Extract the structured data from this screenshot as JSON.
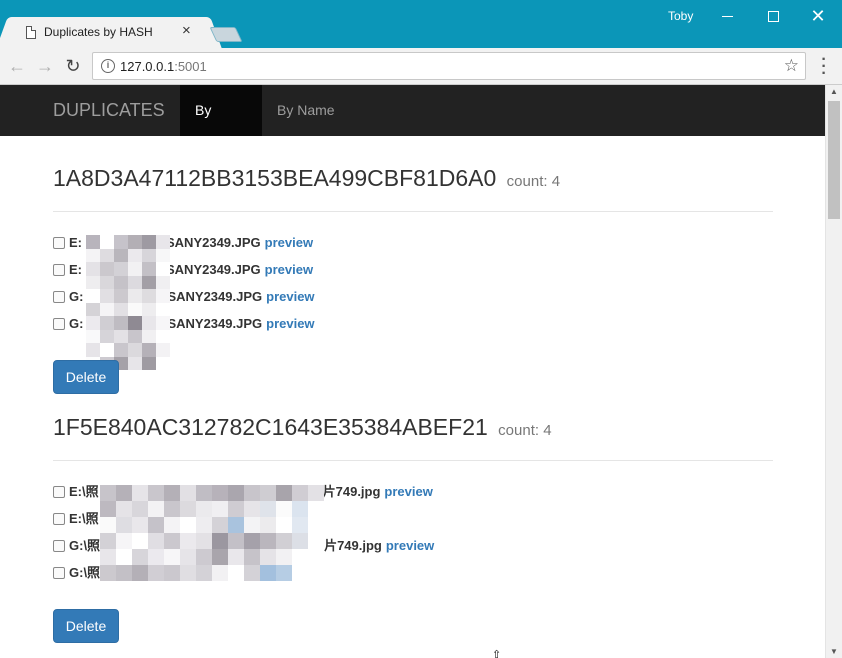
{
  "window": {
    "tab_title": "Duplicates by HASH",
    "user": "Toby",
    "icons": {
      "close_tab": "close-icon",
      "minimize": "minimize-icon",
      "maximize": "maximize-icon",
      "close": "close-icon"
    }
  },
  "toolbar": {
    "url_host": "127.0.0.1",
    "url_port": ":5001",
    "back": "←",
    "forward": "→",
    "reload": "↻",
    "star": "☆",
    "menu": "⋮",
    "info": "i"
  },
  "navbar": {
    "brand": "DUPLICATES",
    "items": [
      {
        "label": "By Hash",
        "active": true
      },
      {
        "label": "By Name",
        "active": false
      }
    ]
  },
  "groups": [
    {
      "hash": "1A8D3A47112BB3153BEA499CBF81D6A0",
      "count_label": "count: 4",
      "files": [
        {
          "prefix": "E:",
          "suffix": "SANY2349.JPG",
          "link": "preview"
        },
        {
          "prefix": "E:",
          "suffix": "SANY2349.JPG",
          "link": "preview"
        },
        {
          "prefix": "G:",
          "suffix": "SANY2349.JPG",
          "link": "preview"
        },
        {
          "prefix": "G:",
          "suffix": "SANY2349.JPG",
          "link": "preview"
        }
      ],
      "delete_label": "Delete"
    },
    {
      "hash": "1F5E840AC312782C1643E35384ABEF21",
      "count_label": "count: 4",
      "files": [
        {
          "prefix": "E:\\照",
          "suffix": "片749.jpg",
          "link": "preview"
        },
        {
          "prefix": "E:\\照",
          "suffix": "",
          "link": ""
        },
        {
          "prefix": "G:\\照",
          "suffix": "片749.jpg",
          "link": "preview"
        },
        {
          "prefix": "G:\\照",
          "suffix": "",
          "link": ""
        }
      ],
      "delete_label": "Delete"
    }
  ],
  "colors": {
    "titlebar": "#0b96b8",
    "navbar": "#222222",
    "navbar_active": "#080808",
    "link": "#337ab7",
    "button": "#337ab7"
  }
}
